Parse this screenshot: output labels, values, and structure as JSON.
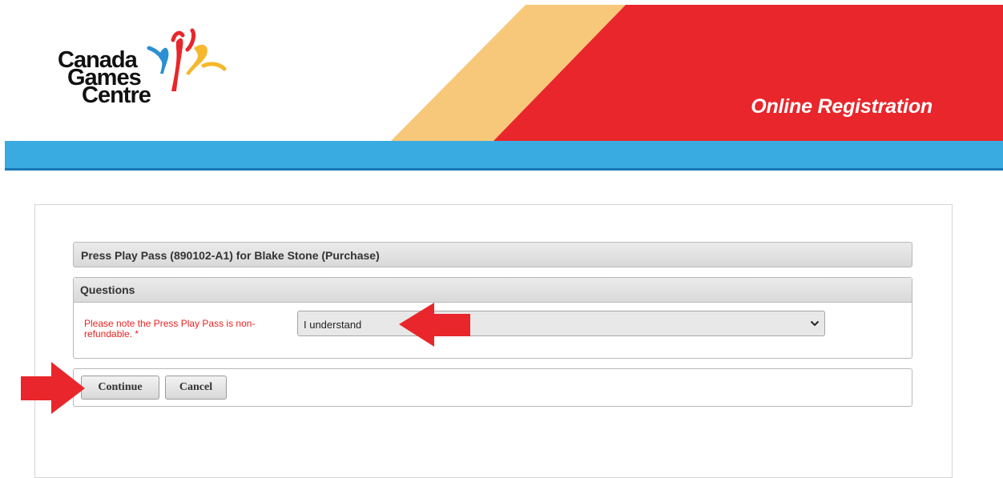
{
  "header": {
    "logo_text": [
      "Canada",
      "Games",
      "Centre"
    ],
    "title": "Online Registration",
    "colors": {
      "red": "#e8262b",
      "yellow": "#f7c87a",
      "blue": "#3aabe0"
    }
  },
  "purchase": {
    "title": "Press Play Pass (890102-A1) for Blake Stone (Purchase)"
  },
  "questions": {
    "heading": "Questions",
    "items": [
      {
        "label": "Please note the Press Play Pass is non-refundable. *",
        "selected_value": "I understand"
      }
    ]
  },
  "actions": {
    "continue_label": "Continue",
    "cancel_label": "Cancel"
  },
  "annotations": {
    "arrow_color": "#e8262b"
  }
}
